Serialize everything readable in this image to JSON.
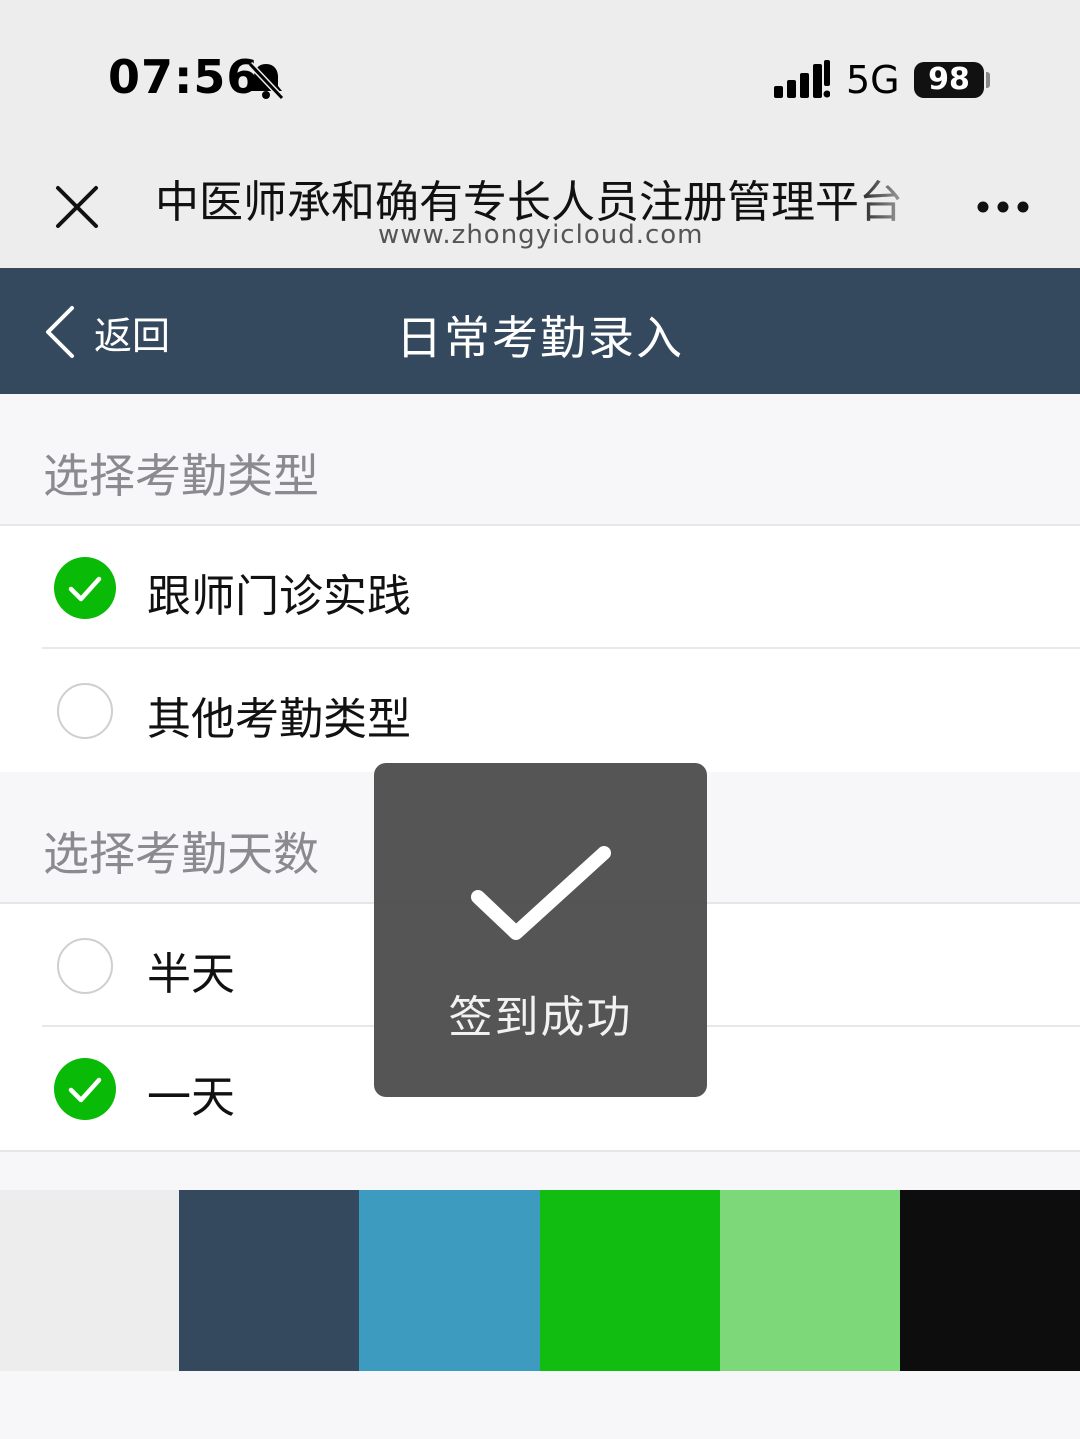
{
  "status_bar": {
    "time": "07:56",
    "network": "5G",
    "battery": "98",
    "icons": [
      "bell-slash-icon",
      "signal-icon"
    ]
  },
  "browser": {
    "title": "中医师承和确有专长人员注册管理平台",
    "url": "www.zhongyicloud.com",
    "icons": [
      "close-icon",
      "more-icon"
    ]
  },
  "nav": {
    "back_label": "返回",
    "title": "日常考勤录入"
  },
  "attendance_type": {
    "header": "选择考勤类型",
    "options": [
      {
        "label": "跟师门诊实践",
        "checked": true
      },
      {
        "label": "其他考勤类型",
        "checked": false
      }
    ]
  },
  "attendance_days": {
    "header": "选择考勤天数",
    "options": [
      {
        "label": "半天",
        "checked": false
      },
      {
        "label": "一天",
        "checked": true
      }
    ]
  },
  "toast": {
    "message": "签到成功",
    "icon": "checkmark-icon"
  },
  "palette": [
    "#ededed",
    "#34495e",
    "#3e9bc0",
    "#10bd10",
    "#7cd878",
    "#0d0d0d"
  ],
  "colors": {
    "nav_bg": "#34495e",
    "accent_green": "#09bb07",
    "toast_bg": "#4e4e4e"
  }
}
